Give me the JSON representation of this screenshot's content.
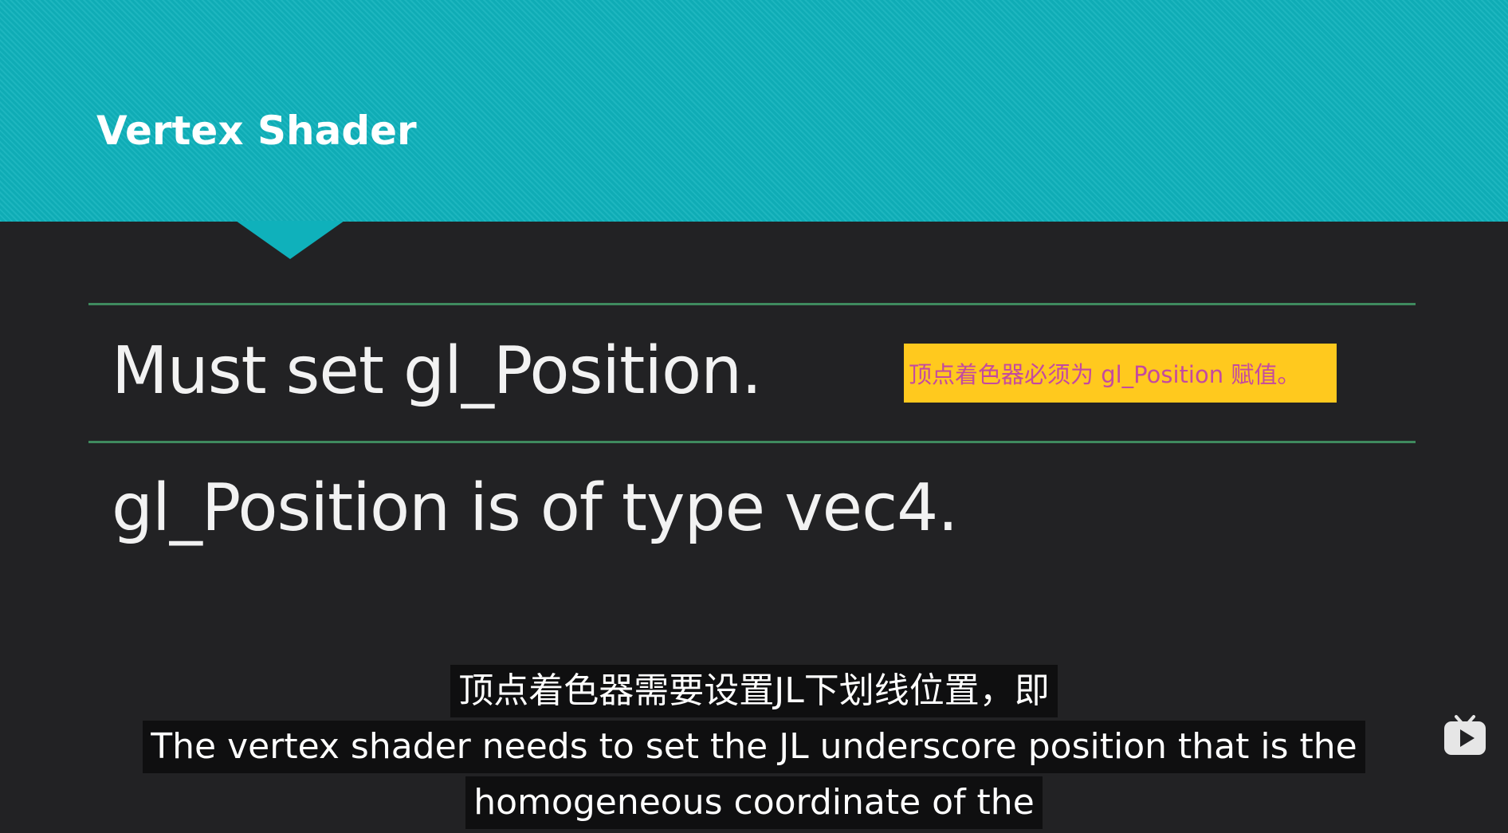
{
  "slide": {
    "title": "Vertex Shader",
    "bullets": [
      "Must set gl_Position.",
      "gl_Position is of type vec4."
    ],
    "note": "顶点着色器必须为 gl_Position 赋值。"
  },
  "subtitles": {
    "chinese": "顶点着色器需要设置JL下划线位置，即",
    "english_line1": "The vertex shader needs to set the JL underscore position that is the",
    "english_line2": "homogeneous coordinate of the"
  },
  "colors": {
    "header": "#0fb1bb",
    "background": "#222224",
    "divider": "#3f8a5e",
    "note_bg": "#ffc91e",
    "note_text": "#c44aa0"
  },
  "icons": {
    "player_logo": "tv-play-icon"
  }
}
